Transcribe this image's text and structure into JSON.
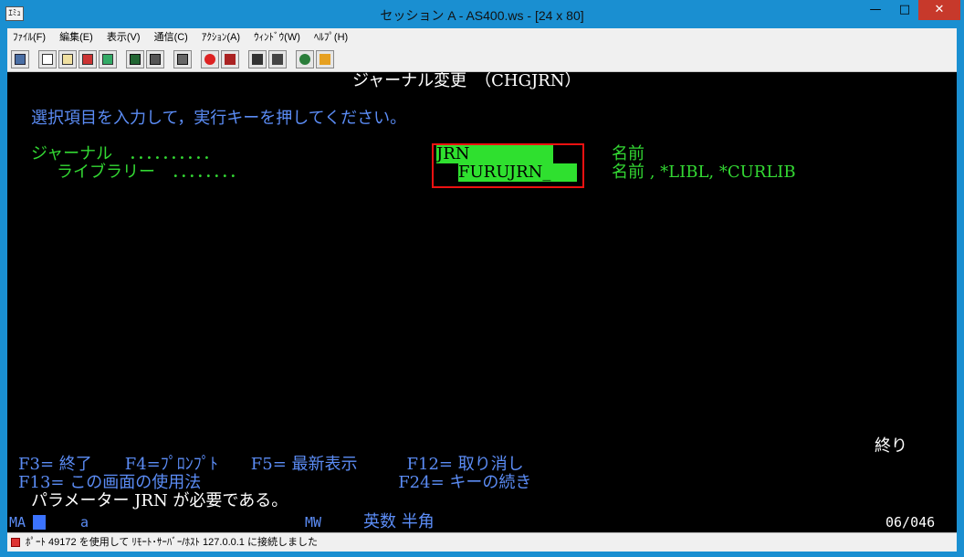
{
  "window": {
    "title": "セッション A - AS400.ws - [24 x 80]",
    "app_icon_label": "ｴﾐｭ"
  },
  "menu": [
    {
      "label": "ﾌｧｲﾙ(F)"
    },
    {
      "label": "編集(E)"
    },
    {
      "label": "表示(V)"
    },
    {
      "label": "通信(C)"
    },
    {
      "label": "ｱｸｼｮﾝ(A)"
    },
    {
      "label": "ｳｨﾝﾄﾞｳ(W)"
    },
    {
      "label": "ﾍﾙﾌﾟ(H)"
    }
  ],
  "toolbar_icons": [
    "print-screen-icon",
    "copy-icon",
    "paste-icon",
    "send-file-icon",
    "receive-file-icon",
    "display-icon",
    "keypad-icon",
    "macro-icon",
    "record-macro-icon",
    "stop-macro-icon",
    "play-macro-icon",
    "customize-icon",
    "globe-icon",
    "edit-icon"
  ],
  "screen": {
    "title": "ジャーナル変更　（CHGJRN）",
    "instruction": "選択項目を入力して，実行キーを押してください。",
    "journal_label": "ジャーナル　．．．．．．．．．．",
    "journal_value": "JRN",
    "journal_hint": "名前",
    "library_label": "ライブラリー　．．．．．．．．",
    "library_value": "FURUJRN_",
    "library_hint": "名前 , *LIBL, *CURLIB",
    "bottom_label": "終り",
    "fkeys_row1": "F3= 終了　　F4=ﾌﾟﾛﾝﾌﾟﾄ　　F5= 最新表示　　　F12= 取り消し",
    "fkeys_row2": "F13= この画面の使用法　　　　　　　　　　　　F24= キーの続き",
    "message": "パラメーター JRN が必要である。"
  },
  "status_line": {
    "mode": "MA",
    "indicator": "a",
    "mw": "MW",
    "input_mode": "英数 半角",
    "cursor_pos": "06/046"
  },
  "statusbar": {
    "message": "ﾎﾟｰﾄ 49172 を使用して ﾘﾓｰﾄ･ｻｰﾊﾞｰ/ﾎｽﾄ 127.0.0.1 に接続しました"
  },
  "colors": {
    "terminal_bg": "#000000",
    "field_green": "#2fe02f",
    "text_green": "#33d833",
    "text_blue": "#5b8cf5",
    "highlight_red": "#e11111"
  }
}
